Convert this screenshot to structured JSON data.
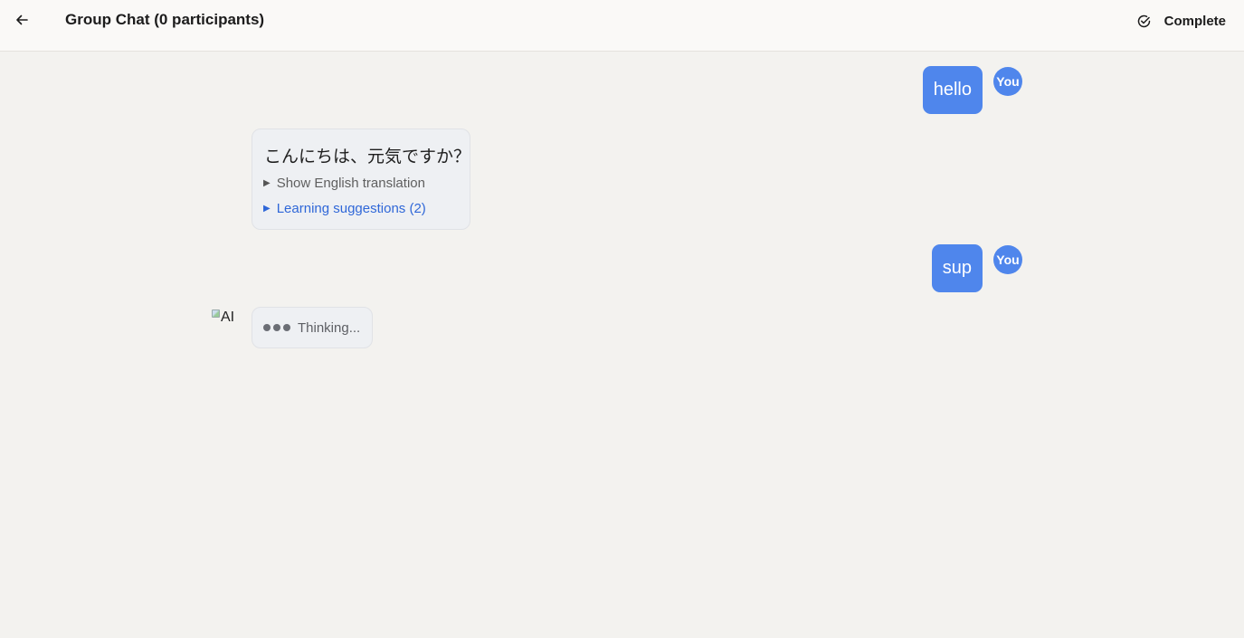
{
  "header": {
    "title": "Group Chat (0 participants)",
    "complete_label": "Complete"
  },
  "messages": [
    {
      "sender": "user",
      "text": "hello",
      "avatar": "You"
    },
    {
      "sender": "ai",
      "text": "こんにちは、元気ですか？",
      "translation_toggle": "Show English translation",
      "suggestions_toggle": "Learning suggestions (2)"
    },
    {
      "sender": "user",
      "text": "sup",
      "avatar": "You"
    },
    {
      "sender": "ai",
      "avatar_alt": "AI",
      "status": "Thinking..."
    }
  ],
  "colors": {
    "accent": "#4f86ec",
    "link": "#2f67d8",
    "background": "#f3f2ef"
  },
  "icons": {
    "back": "arrow-left-icon",
    "complete": "check-circle-icon"
  }
}
